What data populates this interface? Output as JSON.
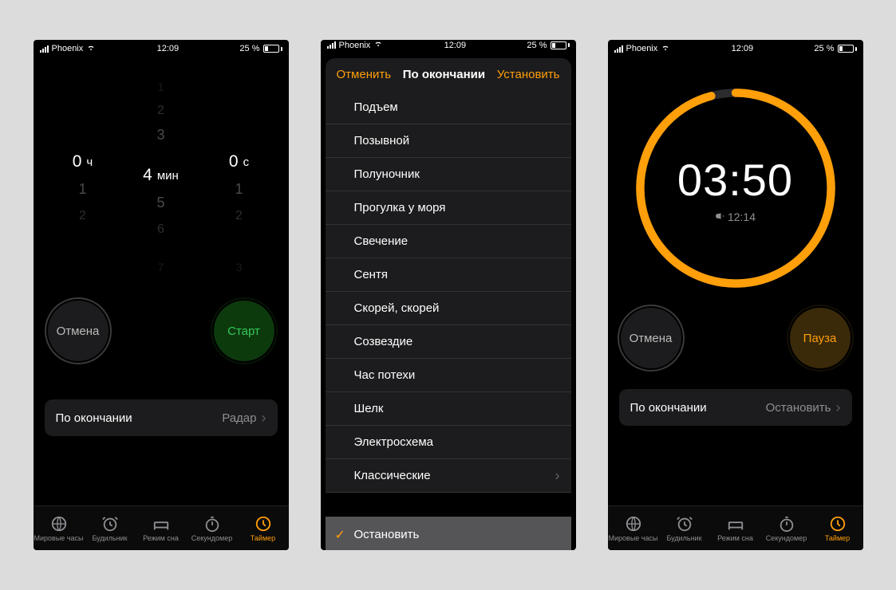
{
  "status_bar": {
    "carrier": "Phoenix",
    "time": "12:09",
    "battery_pct": "25 %"
  },
  "screen1": {
    "picker": {
      "hours": {
        "sel": "0",
        "unit": "ч",
        "below": [
          "1",
          "2"
        ]
      },
      "minutes": {
        "above": [
          "1",
          "2",
          "3"
        ],
        "sel": "4",
        "unit": "мин",
        "below": [
          "5",
          "6",
          "7"
        ]
      },
      "seconds": {
        "sel": "0",
        "unit": "с",
        "below": [
          "1",
          "2",
          "3"
        ]
      }
    },
    "cancel": "Отмена",
    "start": "Старт",
    "end_label": "По окончании",
    "end_value": "Радар"
  },
  "screen2": {
    "cancel": "Отменить",
    "title": "По окончании",
    "set": "Установить",
    "items": [
      "Подъем",
      "Позывной",
      "Полуночник",
      "Прогулка у моря",
      "Свечение",
      "Сентя",
      "Скорей, скорей",
      "Созвездие",
      "Час потехи",
      "Шелк",
      "Электросхема"
    ],
    "classic": "Классические",
    "stop": "Остановить"
  },
  "screen3": {
    "time": "03:50",
    "end_at": "12:14",
    "cancel": "Отмена",
    "pause": "Пауза",
    "end_label": "По окончании",
    "end_value": "Остановить"
  },
  "tabs": {
    "world": "Мировые часы",
    "alarm": "Будильник",
    "sleep": "Режим сна",
    "stopwatch": "Секундомер",
    "timer": "Таймер"
  }
}
